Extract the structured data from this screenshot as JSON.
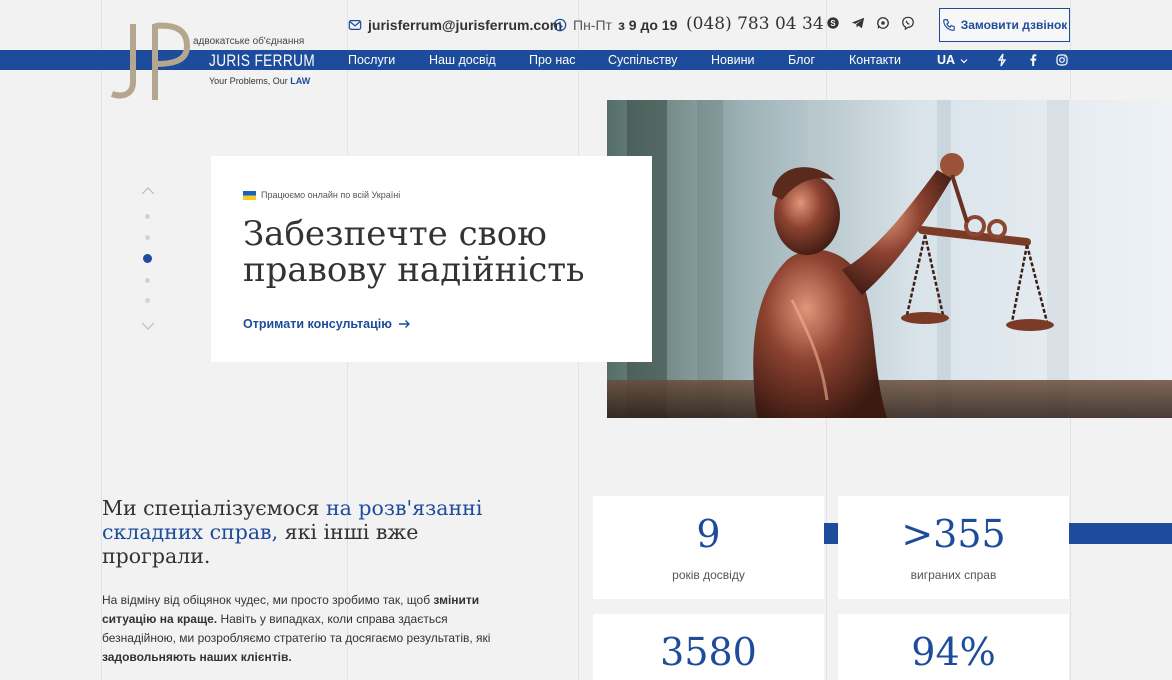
{
  "header": {
    "email": "jurisferrum@jurisferrum.com",
    "hours_prefix": "Пн-Пт",
    "hours_bold": "з 9 до 19",
    "phone": "(048) 783 04 34",
    "call_button": "Замовити дзвінок",
    "socials": [
      "skype-icon",
      "telegram-icon",
      "whatsapp-icon",
      "viber-icon"
    ]
  },
  "logo": {
    "subtitle": "адвокатське об'єднання",
    "name": "JURIS FERRUM",
    "slogan_prefix": "Your Problems, Our",
    "slogan_bold": "LAW"
  },
  "nav": {
    "items": [
      "Послуги",
      "Наш досвід",
      "Про нас",
      "Суспільству",
      "Новини",
      "Блог",
      "Контакти"
    ],
    "lang": "UA",
    "icons": [
      "lightning-icon",
      "facebook-icon",
      "instagram-icon"
    ]
  },
  "hero": {
    "tag": "Працюємо онлайн по всій Україні",
    "title": "Забезпечте свою правову надійність",
    "cta": "Отримати консультацію",
    "slides": 5,
    "active_slide": 3
  },
  "about": {
    "title_start": "Ми спеціалізуємося",
    "title_highlight": "на розв'язанні складних справ,",
    "title_end": "які інші вже програли.",
    "p1": "На відміну від обіцянок чудес, ми просто зробимо так, щоб",
    "p1_bold": "змінити ситуацію на краще.",
    "p2": "Навіть у випадках, коли справа здається безнадійною, ми розробляємо стратегію та досягаємо результатів, які",
    "p2_bold": "задовольняють наших клієнтів."
  },
  "stats": [
    {
      "value": "9",
      "label": "років досвіду"
    },
    {
      "value": ">355",
      "label": "виграних справ"
    },
    {
      "value": "3580",
      "label": ""
    },
    {
      "value": "94%",
      "label": ""
    }
  ],
  "colors": {
    "brand": "#1d4c9c",
    "background": "#f2f2f2",
    "text": "#333333"
  }
}
